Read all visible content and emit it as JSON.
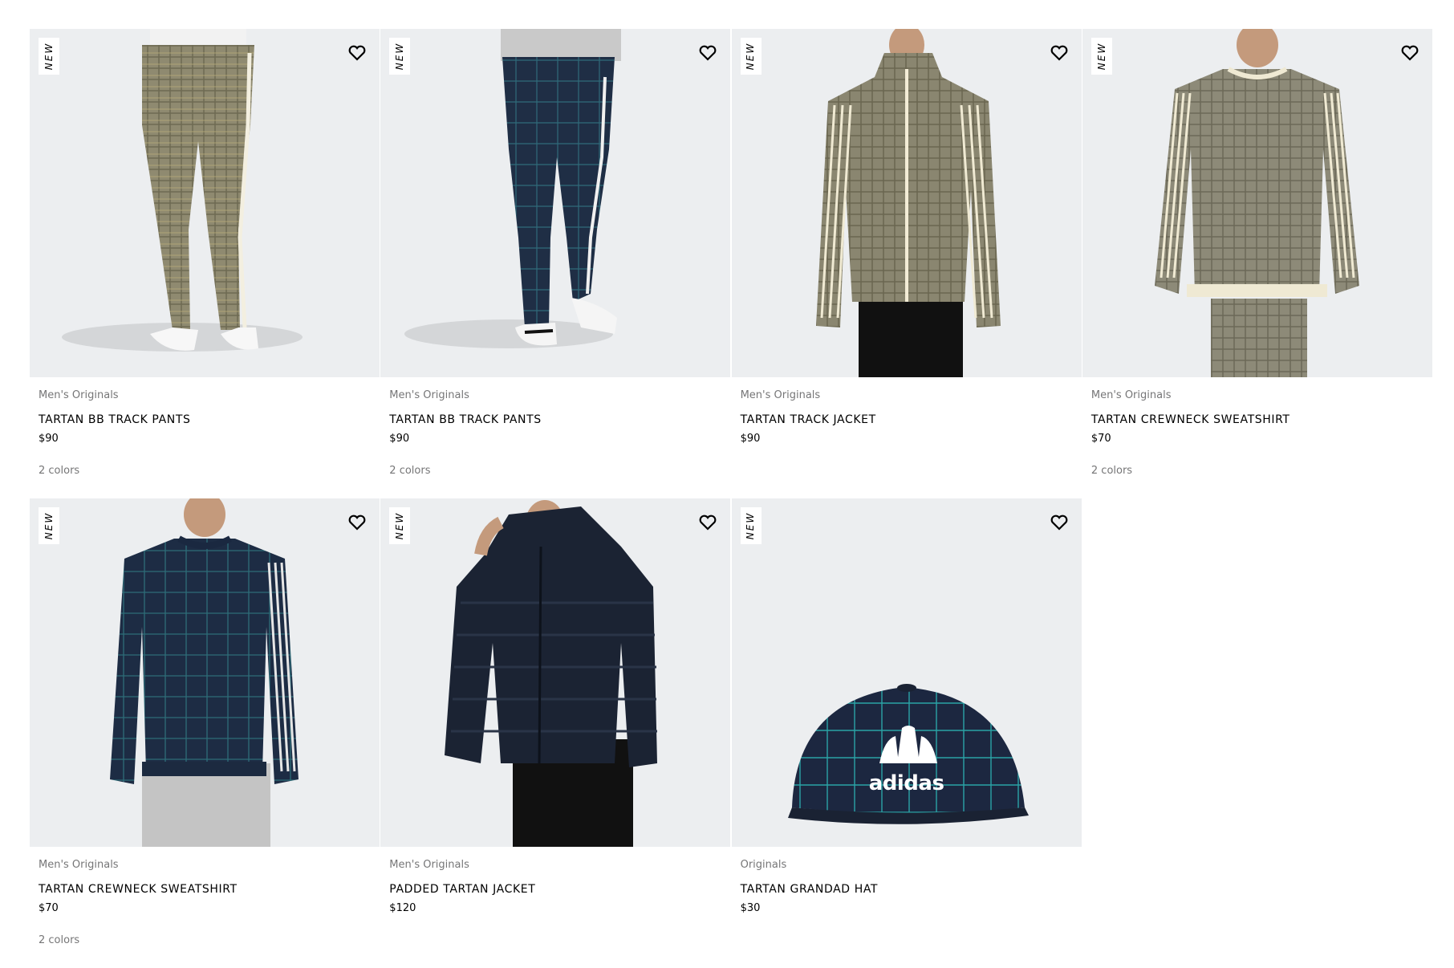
{
  "products": [
    {
      "badge": "NEW",
      "division": "Men's Originals",
      "name": "TARTAN BB TRACK PANTS",
      "price": "$90",
      "colors": "2 colors"
    },
    {
      "badge": "NEW",
      "division": "Men's Originals",
      "name": "TARTAN BB TRACK PANTS",
      "price": "$90",
      "colors": "2 colors"
    },
    {
      "badge": "NEW",
      "division": "Men's Originals",
      "name": "TARTAN TRACK JACKET",
      "price": "$90",
      "colors": ""
    },
    {
      "badge": "NEW",
      "division": "Men's Originals",
      "name": "TARTAN CREWNECK SWEATSHIRT",
      "price": "$70",
      "colors": "2 colors"
    },
    {
      "badge": "NEW",
      "division": "Men's Originals",
      "name": "TARTAN CREWNECK SWEATSHIRT",
      "price": "$70",
      "colors": "2 colors"
    },
    {
      "badge": "NEW",
      "division": "Men's Originals",
      "name": "PADDED TARTAN JACKET",
      "price": "$120",
      "colors": ""
    },
    {
      "badge": "NEW",
      "division": "Originals",
      "name": "TARTAN GRANDAD HAT",
      "price": "$30",
      "colors": ""
    }
  ],
  "logo_text": "adidas",
  "icons": {
    "wishlist": "heart-outline-icon"
  },
  "colors": {
    "image_bg": "#eceef0",
    "muted_text": "#767677",
    "plaid_tan": "#8a8468",
    "plaid_navy": "#1f3048"
  }
}
